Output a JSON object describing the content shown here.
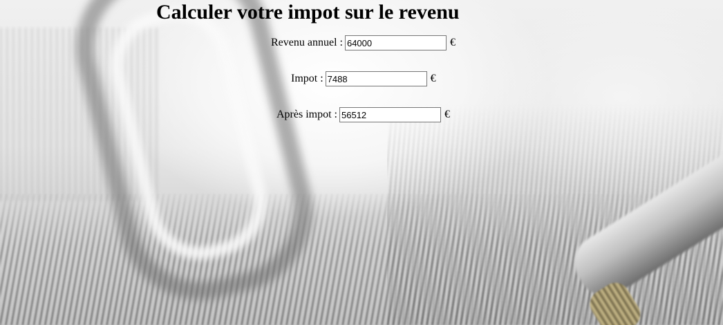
{
  "page": {
    "title": "Calculer votre impot sur le revenu"
  },
  "form": {
    "revenu": {
      "label": "Revenu annuel :",
      "value": "64000",
      "unit": "€"
    },
    "impot": {
      "label": "Impot :",
      "value": "7488",
      "unit": "€"
    },
    "apres_impot": {
      "label": "Après impot :",
      "value": "56512",
      "unit": "€"
    }
  }
}
